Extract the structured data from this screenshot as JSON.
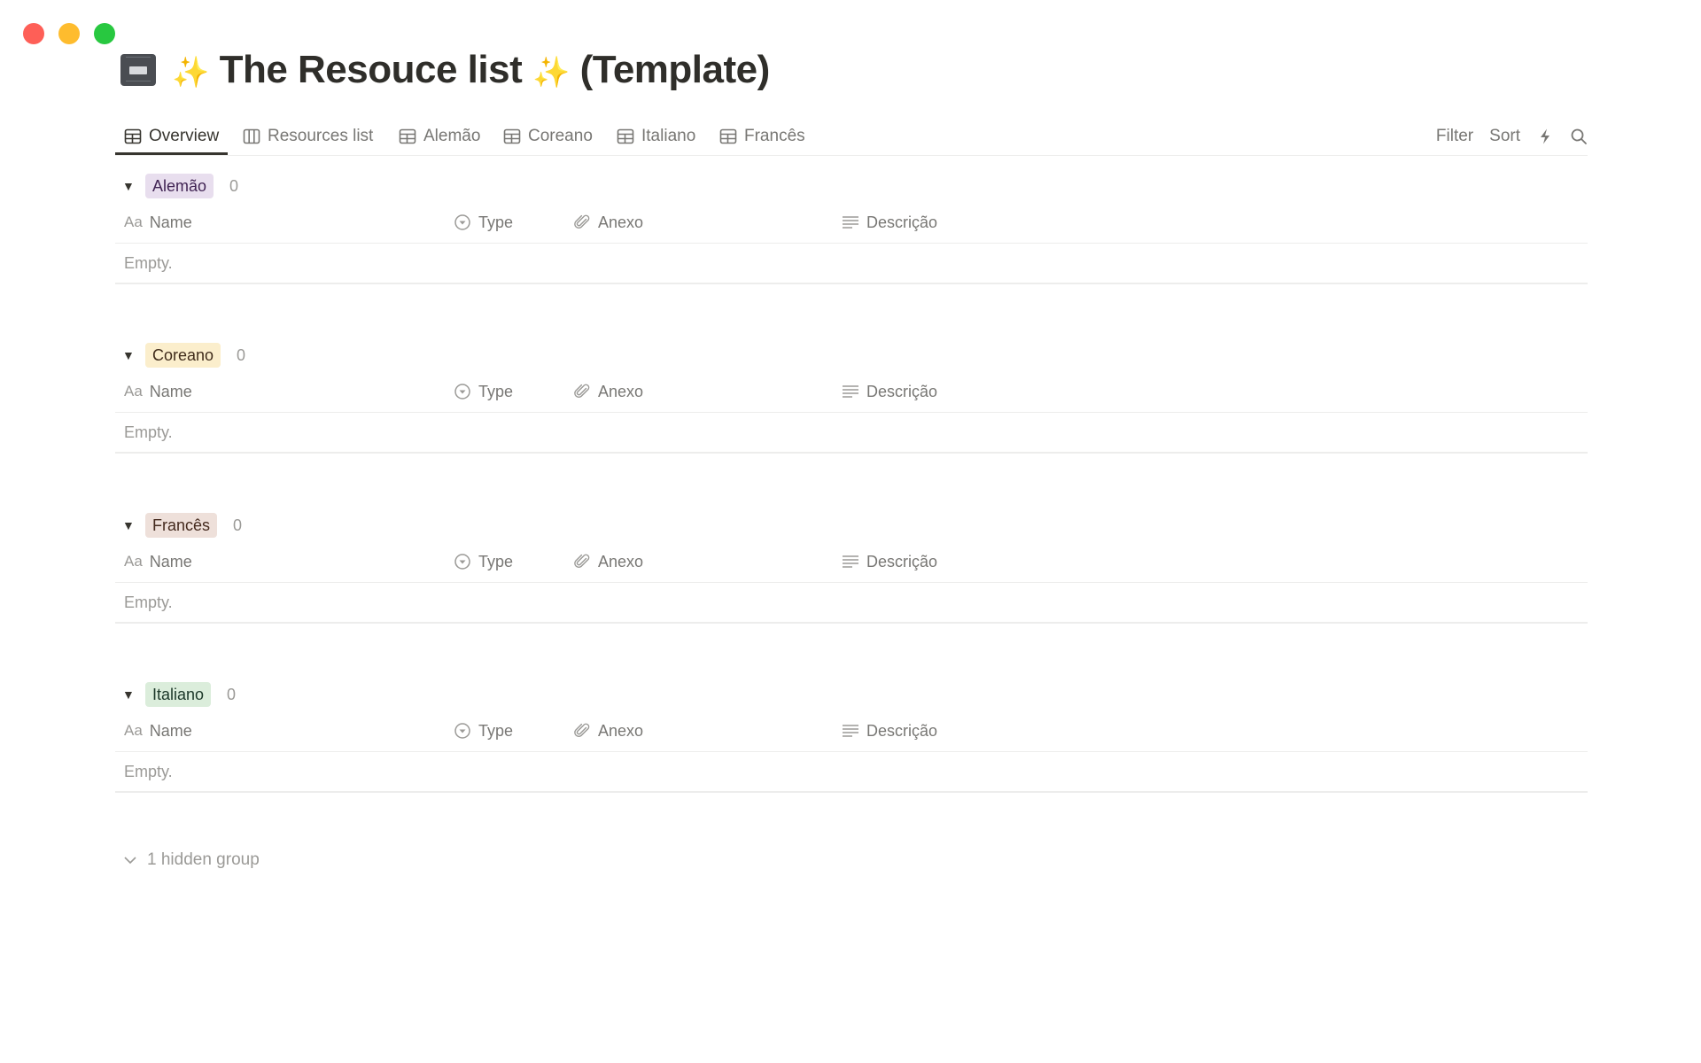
{
  "window": {
    "controls": [
      "close",
      "minimize",
      "maximize"
    ]
  },
  "page": {
    "icon": "file-cabinet-icon",
    "title_prefix": "✨",
    "title_text": "The Resouce list",
    "title_mid": "✨",
    "title_suffix": "(Template)"
  },
  "tabs": [
    {
      "label": "Overview",
      "icon": "table-icon",
      "active": true
    },
    {
      "label": "Resources list",
      "icon": "board-icon",
      "active": false
    },
    {
      "label": "Alemão",
      "icon": "table-icon",
      "active": false
    },
    {
      "label": "Coreano",
      "icon": "table-icon",
      "active": false
    },
    {
      "label": "Italiano",
      "icon": "table-icon",
      "active": false
    },
    {
      "label": "Francês",
      "icon": "table-icon",
      "active": false
    }
  ],
  "toolbar": {
    "filter": "Filter",
    "sort": "Sort"
  },
  "columns": {
    "name_prefix": "Aa",
    "name": "Name",
    "type": "Type",
    "anexo": "Anexo",
    "descricao": "Descrição"
  },
  "groups": [
    {
      "label": "Alemão",
      "count": "0",
      "empty": "Empty.",
      "bg": "#e8deee",
      "fg": "#412454"
    },
    {
      "label": "Coreano",
      "count": "0",
      "empty": "Empty.",
      "bg": "#fbeecc",
      "fg": "#402c1b"
    },
    {
      "label": "Francês",
      "count": "0",
      "empty": "Empty.",
      "bg": "#eee0da",
      "fg": "#442a1e"
    },
    {
      "label": "Italiano",
      "count": "0",
      "empty": "Empty.",
      "bg": "#dbeddb",
      "fg": "#1c3829"
    }
  ],
  "hidden_groups": "1 hidden group"
}
